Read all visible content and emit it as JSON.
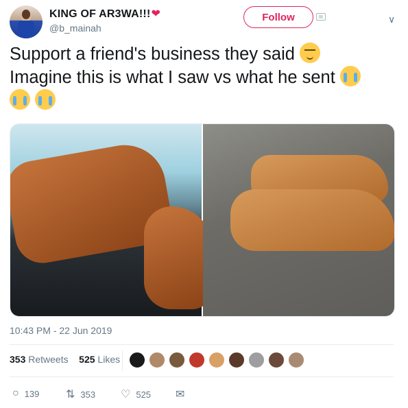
{
  "user": {
    "display_name": "KING OF AR3WA!!!",
    "heart": "❤",
    "handle": "@b_mainah",
    "follow_label": "Follow"
  },
  "tweet": {
    "line1": "Support a friend's business they said",
    "line2": "Imagine this is what I saw vs what he sent",
    "emojis": [
      "relieved-face",
      "loudly-crying-face",
      "loudly-crying-face",
      "loudly-crying-face"
    ]
  },
  "media": {
    "left_image": "brown leather tassel loafers on a chair",
    "right_image": "tan leather shoes with laces on a floor"
  },
  "meta": {
    "timestamp": "10:43 PM - 22 Jun 2019"
  },
  "stats": {
    "retweets_count": "353",
    "retweets_label": "Retweets",
    "likes_count": "525",
    "likes_label": "Likes"
  },
  "likers": [
    "#1a1a1a",
    "#b08968",
    "#7a5a3c",
    "#c0392b",
    "#d9a066",
    "#5a3b2a",
    "#9e9e9e",
    "#6b4a3a",
    "#a98b73"
  ],
  "actions": {
    "reply_count": "139",
    "retweet_count": "353",
    "like_count": "525"
  },
  "colors": {
    "accent": "#e0245e",
    "secondary_text": "#657786"
  }
}
